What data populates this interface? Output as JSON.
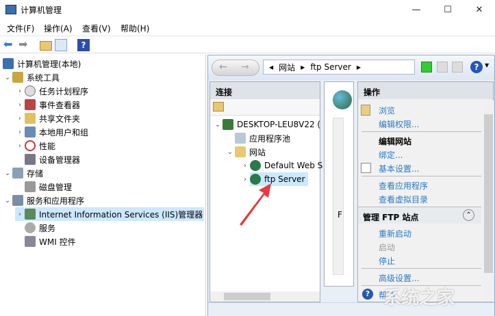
{
  "window": {
    "title": "计算机管理",
    "minimize": "—",
    "maximize": "☐",
    "close": "✕"
  },
  "menu": [
    "文件(F)",
    "操作(A)",
    "查看(V)",
    "帮助(H)"
  ],
  "tree": {
    "root": "计算机管理(本地)",
    "items": [
      {
        "label": "系统工具",
        "level": 1,
        "expanded": true
      },
      {
        "label": "任务计划程序",
        "level": 2
      },
      {
        "label": "事件查看器",
        "level": 2
      },
      {
        "label": "共享文件夹",
        "level": 2
      },
      {
        "label": "本地用户和组",
        "level": 2
      },
      {
        "label": "性能",
        "level": 2
      },
      {
        "label": "设备管理器",
        "level": 2
      },
      {
        "label": "存储",
        "level": 1,
        "expanded": true
      },
      {
        "label": "磁盘管理",
        "level": 2
      },
      {
        "label": "服务和应用程序",
        "level": 1,
        "expanded": true
      },
      {
        "label": "Internet Information Services (IIS)管理器",
        "level": 2,
        "selected": true
      },
      {
        "label": "服务",
        "level": 2
      },
      {
        "label": "WMI 控件",
        "level": 2
      }
    ]
  },
  "iis": {
    "breadcrumb": [
      "网站",
      "ftp Server"
    ],
    "connections": {
      "title": "连接",
      "server": "DESKTOP-LEU8V22 (",
      "app_pools": "应用程序池",
      "sites": "网站",
      "site1": "Default Web S",
      "site2": "ftp Server"
    },
    "middle_text": "F",
    "actions": {
      "title": "操作",
      "browse": "浏览",
      "edit_perm": "编辑权限...",
      "edit_site": "编辑网站",
      "bindings": "绑定...",
      "basic": "基本设置...",
      "view_apps": "查看应用程序",
      "view_vdirs": "查看虚拟目录",
      "ftp_section": "管理 FTP 站点",
      "restart": "重新启动",
      "start": "启动",
      "stop": "停止",
      "advanced": "高级设置...",
      "help": "帮助"
    }
  },
  "watermark": "系统之家"
}
